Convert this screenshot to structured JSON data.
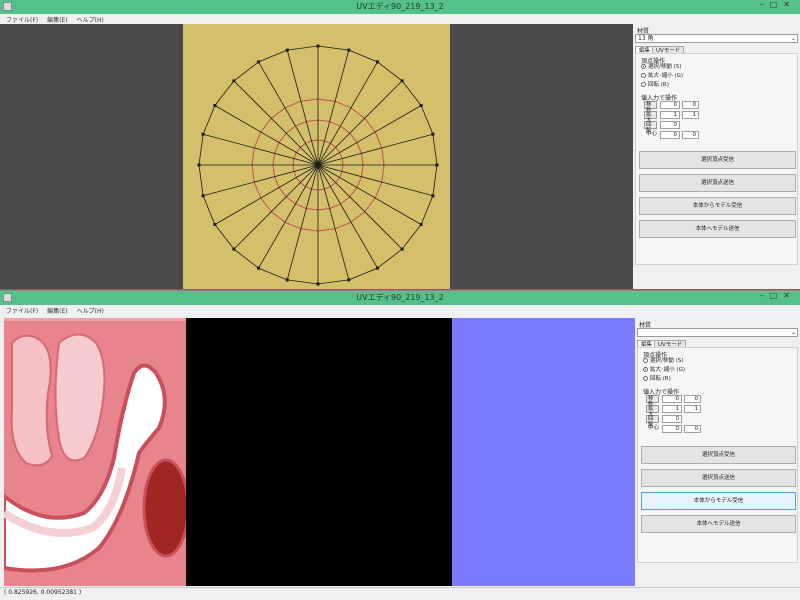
{
  "top_window": {
    "title": "UVエディ90_219_13_2",
    "menu": [
      "ファイル(F)",
      "編集(E)",
      "ヘルプ(H)"
    ],
    "material_label": "材質",
    "material_value": "13 角",
    "tabs": [
      "編集",
      "UVモード"
    ],
    "vertex_ops_label": "頂点操作",
    "radios": [
      {
        "label": "選択/移動 (S)",
        "checked": true
      },
      {
        "label": "拡大･縮小 (G)",
        "checked": false
      },
      {
        "label": "回転 (R)",
        "checked": false
      }
    ],
    "numeric_label": "値入力で操作",
    "rows": [
      {
        "label": "移動",
        "v1": "0",
        "v2": "0"
      },
      {
        "label": "拡大",
        "v1": "1",
        "v2": "1"
      },
      {
        "label": "回転",
        "v1": "0",
        "v2": ""
      },
      {
        "label": "中心",
        "v1": "0",
        "v2": "0"
      }
    ],
    "buttons": [
      "選択頂点受信",
      "選択頂点送信",
      "本体からモデル受信",
      "本体へモデル送信"
    ],
    "colors": {
      "canvas_bg": "#4a4a4a",
      "texture": "#d4c06a",
      "wire": "#1a1a1a",
      "rings": "#c0504d"
    }
  },
  "bottom_window": {
    "title": "UVエディ90_219_13_2",
    "menu": [
      "ファイル(F)",
      "編集(E)",
      "ヘルプ(H)"
    ],
    "material_label": "材質",
    "material_value": "",
    "tabs": [
      "編集",
      "UVモード"
    ],
    "vertex_ops_label": "頂点操作",
    "radios": [
      {
        "label": "選択/移動 (S)",
        "checked": false
      },
      {
        "label": "拡大･縮小 (G)",
        "checked": true
      },
      {
        "label": "回転 (R)",
        "checked": false
      }
    ],
    "numeric_label": "値入力で操作",
    "rows": [
      {
        "label": "移動",
        "v1": "0",
        "v2": "0"
      },
      {
        "label": "拡大",
        "v1": "1",
        "v2": "1"
      },
      {
        "label": "回転",
        "v1": "0",
        "v2": ""
      },
      {
        "label": "中心",
        "v1": "0",
        "v2": "0"
      }
    ],
    "buttons": [
      "選択頂点受信",
      "選択頂点送信",
      "本体からモデル受信",
      "本体へモデル送信"
    ],
    "status": "( 0.825926, 0.00952381 )",
    "colors": {
      "texture": "#e8848c",
      "black": "#000000",
      "blue": "#7b7bff"
    }
  }
}
